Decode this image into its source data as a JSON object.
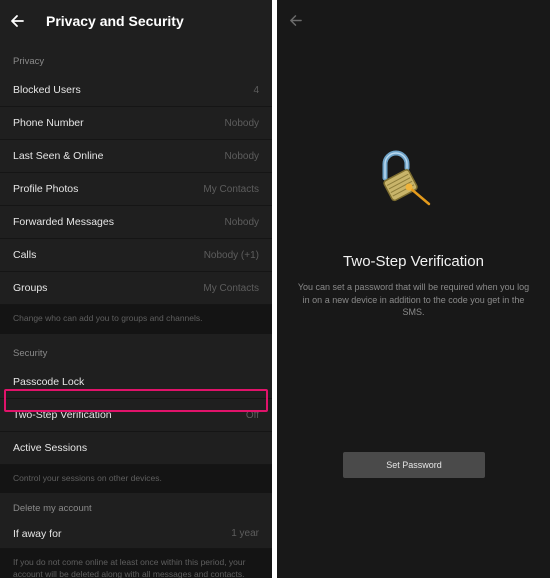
{
  "left": {
    "title": "Privacy and Security",
    "privacy": {
      "header": "Privacy",
      "rows": [
        {
          "label": "Blocked Users",
          "value": "4"
        },
        {
          "label": "Phone Number",
          "value": "Nobody"
        },
        {
          "label": "Last Seen & Online",
          "value": "Nobody"
        },
        {
          "label": "Profile Photos",
          "value": "My Contacts"
        },
        {
          "label": "Forwarded Messages",
          "value": "Nobody"
        },
        {
          "label": "Calls",
          "value": "Nobody (+1)"
        },
        {
          "label": "Groups",
          "value": "My Contacts"
        }
      ],
      "hint": "Change who can add you to groups and channels."
    },
    "security": {
      "header": "Security",
      "rows": [
        {
          "label": "Passcode Lock",
          "value": ""
        },
        {
          "label": "Two-Step Verification",
          "value": "Off"
        },
        {
          "label": "Active Sessions",
          "value": ""
        }
      ],
      "hint": "Control your sessions on other devices."
    },
    "delete": {
      "header": "Delete my account",
      "rows": [
        {
          "label": "If away for",
          "value": "1 year"
        }
      ],
      "hint": "If you do not come online at least once within this period, your account will be deleted along with all messages and contacts."
    },
    "highlight_color": "#e0136a"
  },
  "right": {
    "title": "Two-Step Verification",
    "description": "You can set a password that will be required when you log in on a new device in addition to the code you get in the SMS.",
    "button_label": "Set Password",
    "icons": {
      "back": "back-arrow-icon",
      "lock": "open-padlock-icon"
    }
  }
}
